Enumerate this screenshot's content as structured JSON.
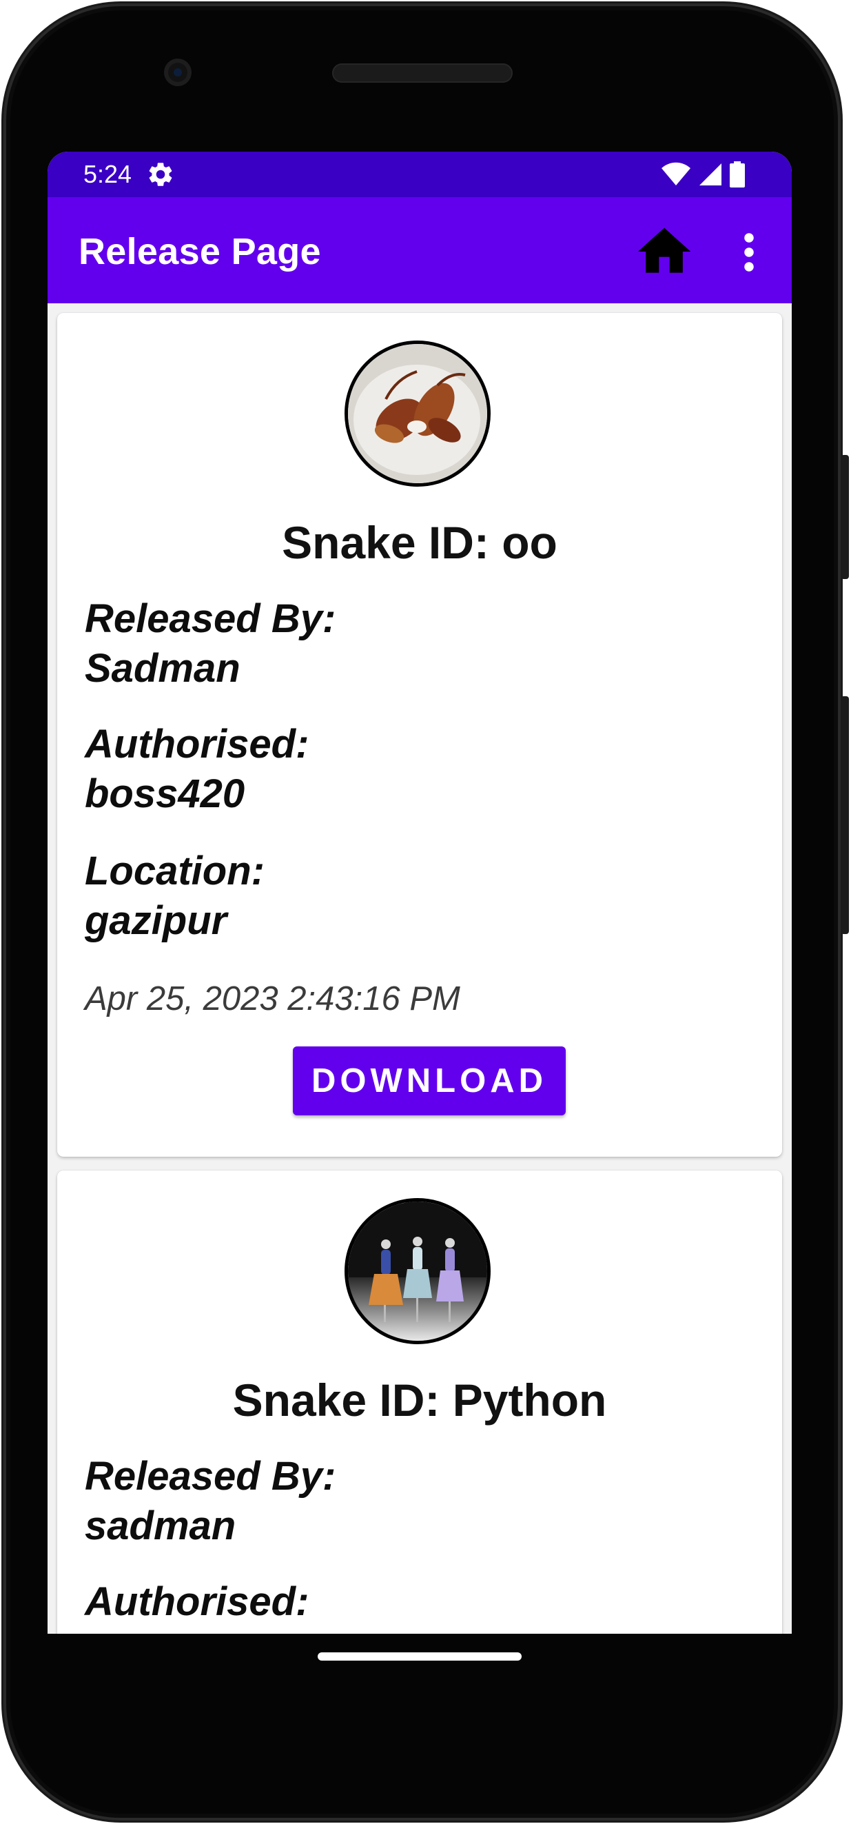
{
  "status_bar": {
    "time": "5:24",
    "icons": [
      "settings-gear-icon",
      "wifi-icon",
      "cell-signal-icon",
      "battery-icon"
    ]
  },
  "app_bar": {
    "title": "Release Page",
    "home_icon": "home-icon",
    "menu_icon": "more-vert-icon"
  },
  "colors": {
    "status_bar": "#3a00c4",
    "app_bar": "#6200ee",
    "button": "#6200ee"
  },
  "releases": [
    {
      "image": "fried-crayfish-photo",
      "snake_id": "Snake ID: oo",
      "released_by_label": "Released By:",
      "released_by": "Sadman",
      "authorised_label": "Authorised:",
      "authorised": "boss420",
      "location_label": "Location:",
      "location": "gazipur",
      "timestamp": "Apr 25, 2023 2:43:16 PM",
      "download_label": "DOWNLOAD"
    },
    {
      "image": "mannequins-stock-photo",
      "snake_id": "Snake ID: Python",
      "released_by_label": "Released By:",
      "released_by": "sadman",
      "authorised_label": "Authorised:"
    }
  ]
}
